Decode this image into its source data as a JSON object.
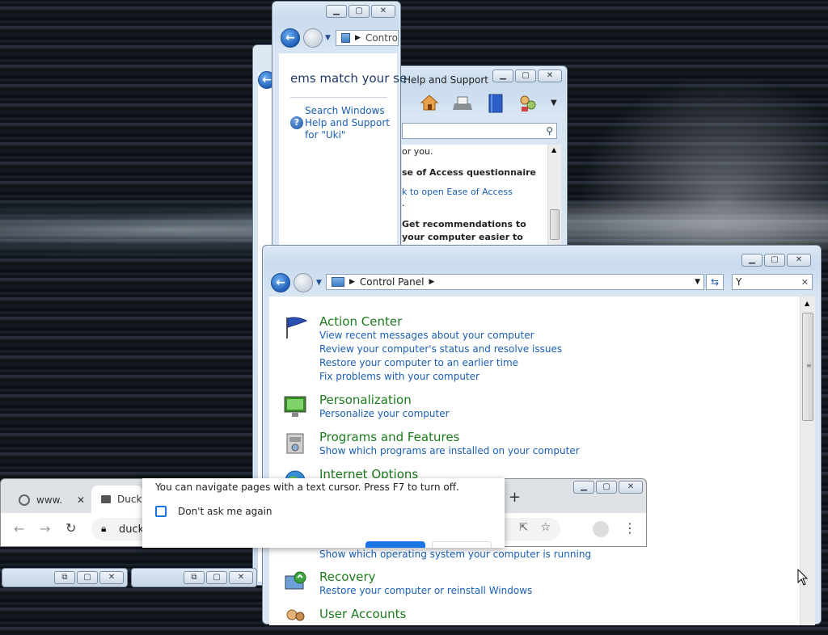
{
  "search_window": {
    "address": "Contro",
    "results_text": "ems match your se",
    "help_link": [
      "Search Windows",
      "Help and Support",
      "for \"Uki\""
    ]
  },
  "help_window": {
    "title": "Help and Support",
    "line_for_you": "or you.",
    "heading_questionnaire": "se of Access questionnaire",
    "link_open": "k to open Ease of Access",
    "heading_get": "Get recommendations to",
    "heading_get2": "your computer easier to"
  },
  "control_panel": {
    "breadcrumb": "Control Panel",
    "search_value": "Y",
    "categories": [
      {
        "title": "Action Center",
        "links": [
          "View recent messages about your computer",
          "Review your computer's status and resolve issues",
          "Restore your computer to an earlier time",
          "Fix problems with your computer"
        ]
      },
      {
        "title": "Personalization",
        "links": [
          "Personalize your computer"
        ]
      },
      {
        "title": "Programs and Features",
        "links": [
          "Show which programs are installed on your computer"
        ]
      },
      {
        "title": "Internet Options",
        "links": []
      },
      {
        "title": "",
        "links": [
          "Show which operating system your computer is running"
        ]
      },
      {
        "title": "Recovery",
        "links": [
          "Restore your computer or reinstall Windows"
        ]
      },
      {
        "title": "User Accounts",
        "links": []
      }
    ]
  },
  "browser": {
    "tab1": "www.",
    "tab2": "Duck",
    "url": "duck",
    "new_tab": "+"
  },
  "caret_popup": {
    "message": "You can navigate pages with a text cursor. Press F7 to turn off.",
    "checkbox_label": "Don't ask me again"
  }
}
